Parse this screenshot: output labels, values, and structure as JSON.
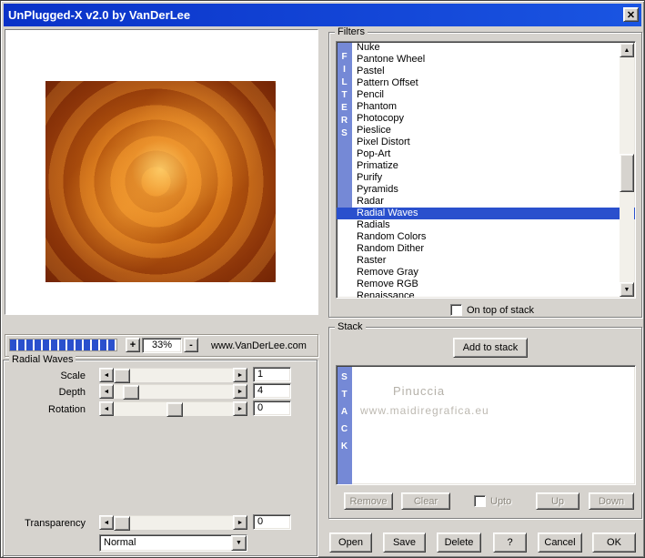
{
  "window": {
    "title": "UnPlugged-X v2.0 by VanDerLee",
    "close": "✕"
  },
  "icons": {
    "arrow_left": "◄",
    "arrow_right": "►",
    "arrow_up": "▲",
    "arrow_down": "▼"
  },
  "zoom": {
    "plus": "+",
    "minus": "-",
    "value": "33%",
    "website": "www.VanDerLee.com"
  },
  "params": {
    "group_title": "Radial Waves",
    "sliders": [
      {
        "label": "Scale",
        "value": "1"
      },
      {
        "label": "Depth",
        "value": "4"
      },
      {
        "label": "Rotation",
        "value": "0"
      }
    ],
    "transparency": {
      "label": "Transparency",
      "value": "0"
    },
    "blend_mode": "Normal"
  },
  "filters": {
    "group_title": "Filters",
    "vertical_label": "FILTERS",
    "selected": "Radial Waves",
    "items": [
      "Nuke",
      "Pantone Wheel",
      "Pastel",
      "Pattern Offset",
      "Pencil",
      "Phantom",
      "Photocopy",
      "Pieslice",
      "Pixel Distort",
      "Pop-Art",
      "Primatize",
      "Purify",
      "Pyramids",
      "Radar",
      "Radial Waves",
      "Radials",
      "Random Colors",
      "Random Dither",
      "Raster",
      "Remove Gray",
      "Remove RGB",
      "Renaissance"
    ],
    "on_top_label": "On top of stack"
  },
  "stack": {
    "group_title": "Stack",
    "vertical_label": "STACK",
    "add_button": "Add to stack",
    "watermark_line1": "Pinuccia",
    "watermark_line2": "www.maidiregrafica.eu",
    "remove_button": "Remove",
    "clear_button": "Clear",
    "upto_label": "Upto",
    "up_button": "Up",
    "down_button": "Down"
  },
  "footer": {
    "open": "Open",
    "save": "Save",
    "delete": "Delete",
    "help": "?",
    "cancel": "Cancel",
    "ok": "OK"
  },
  "colors": {
    "titlebar_blue": "#0a32c8",
    "selection_blue": "#2a50cd",
    "strip_blue": "#7589d6",
    "zoom_segment_blue": "#2a50cd",
    "dialog_gray": "#d6d3ce",
    "preview_dark_red": "#712305",
    "preview_orange": "#cb6610",
    "preview_light_orange": "#f5b040"
  }
}
